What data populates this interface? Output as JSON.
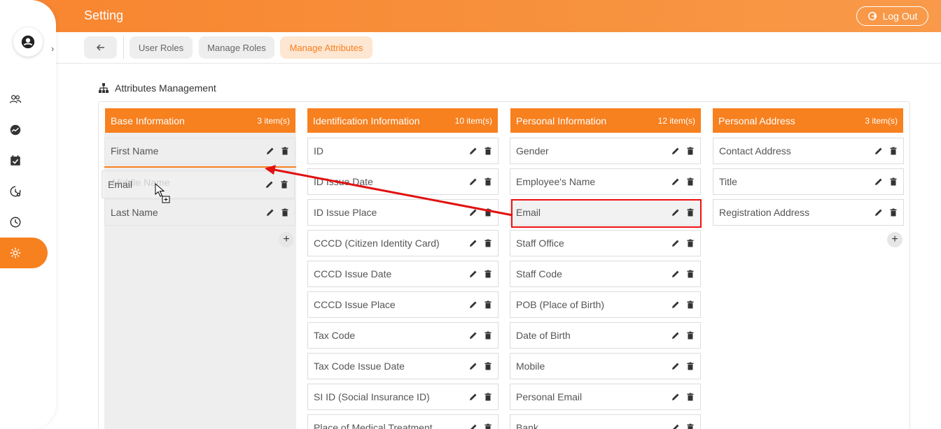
{
  "header": {
    "title": "Setting",
    "logout_label": "Log Out"
  },
  "sidebar": {
    "expand_glyph": "›",
    "items": [
      {
        "icon": "users-icon"
      },
      {
        "icon": "dashboard-icon"
      },
      {
        "icon": "calendar-check-icon"
      },
      {
        "icon": "history-settings-icon"
      },
      {
        "icon": "clock-icon"
      },
      {
        "icon": "gear-icon",
        "active": true
      }
    ]
  },
  "tabs": [
    {
      "label": "User Roles"
    },
    {
      "label": "Manage Roles"
    },
    {
      "label": "Manage Attributes",
      "active": true
    }
  ],
  "section": {
    "title": "Attributes Management"
  },
  "columns": [
    {
      "name": "Base Information",
      "count": "3 item(s)",
      "items": [
        "First Name",
        "Middle Name",
        "Last Name"
      ]
    },
    {
      "name": "Identification Information",
      "count": "10 item(s)",
      "items": [
        "ID",
        "ID Issue Date",
        "ID Issue Place",
        "CCCD (Citizen Identity Card)",
        "CCCD Issue Date",
        "CCCD Issue Place",
        "Tax Code",
        "Tax Code Issue Date",
        "SI ID (Social Insurance ID)",
        "Place of Medical Treatment"
      ]
    },
    {
      "name": "Personal Information",
      "count": "12 item(s)",
      "items": [
        "Gender",
        "Employee's Name",
        "Email",
        "Staff Office",
        "Staff Code",
        "POB (Place of Birth)",
        "Date of Birth",
        "Mobile",
        "Personal Email",
        "Bank"
      ]
    },
    {
      "name": "Personal Address",
      "count": "3 item(s)",
      "items": [
        "Contact Address",
        "Title",
        "Registration Address"
      ]
    }
  ],
  "drag": {
    "dragged_label": "Email"
  },
  "colors": {
    "accent": "#f7801f",
    "annotation": "#e11111"
  }
}
